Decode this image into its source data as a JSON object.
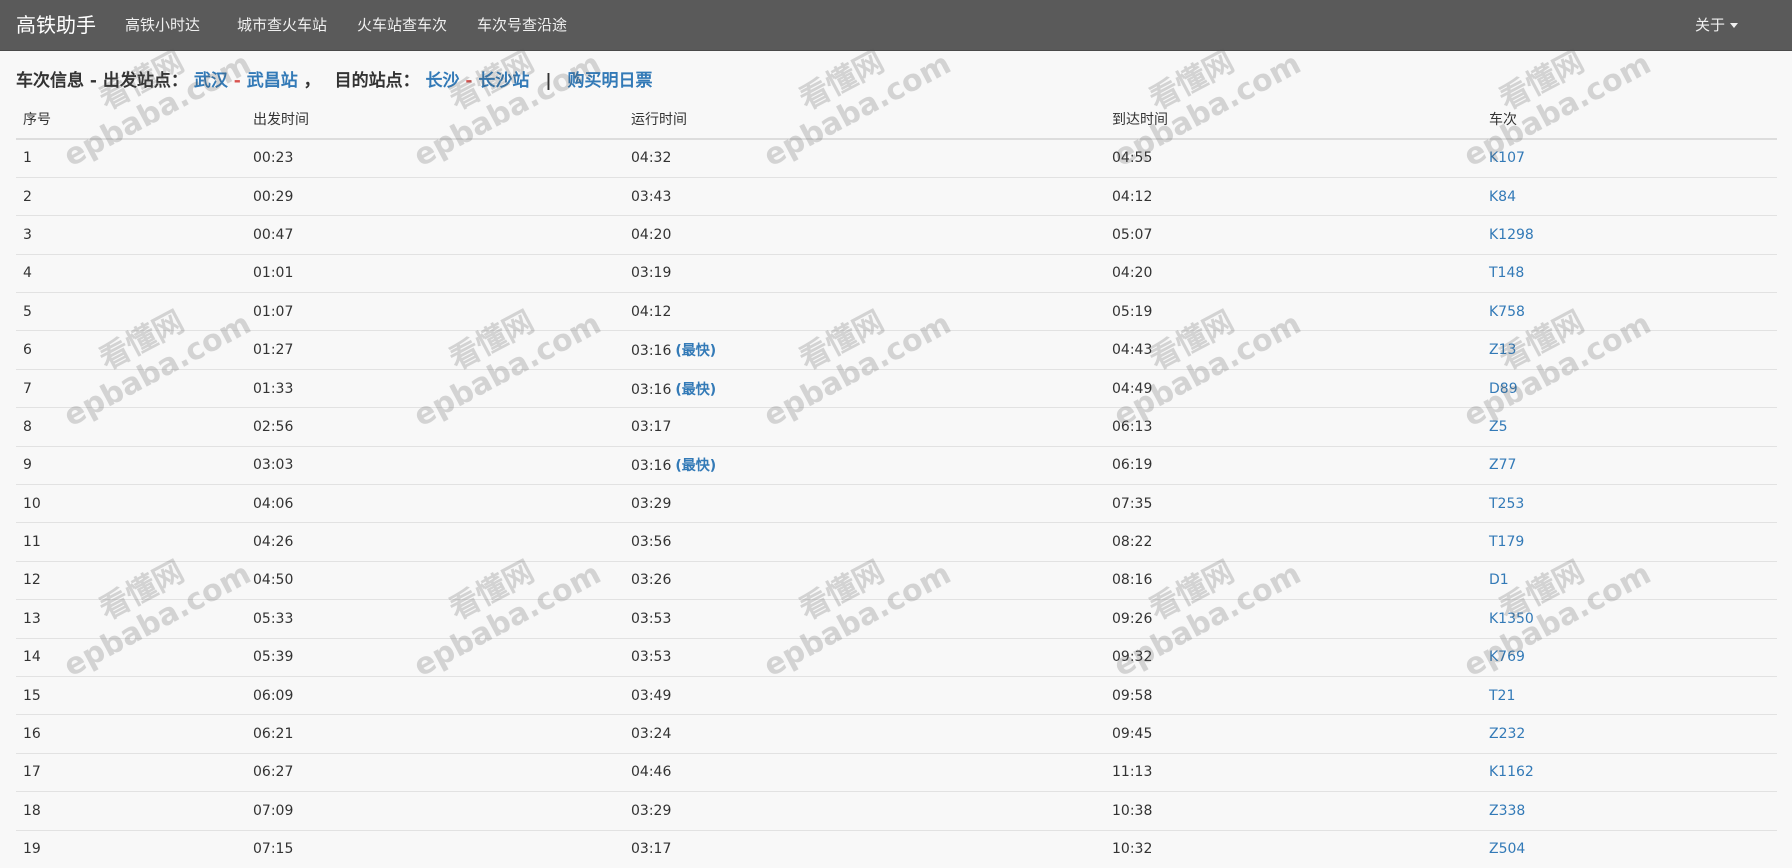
{
  "navbar": {
    "brand": "高铁助手",
    "items": [
      "高铁小时达",
      "城市查火车站",
      "火车站查车次",
      "车次号查沿途"
    ],
    "about": "关于"
  },
  "info": {
    "prefix": "车次信息 - 出发站点：",
    "from_city": "武汉",
    "dash": "-",
    "from_station": "武昌站",
    "separator": "，",
    "dest_label": "目的站点：",
    "to_city": "长沙",
    "to_station": "长沙站",
    "bar": "|",
    "buy": "购买明日票"
  },
  "table": {
    "headers": [
      "序号",
      "出发时间",
      "运行时间",
      "到达时间",
      "车次"
    ],
    "fast_label": "(最快)",
    "rows": [
      {
        "no": "1",
        "dep": "00:23",
        "dur": "04:32",
        "arr": "04:55",
        "train": "K107",
        "fast": false
      },
      {
        "no": "2",
        "dep": "00:29",
        "dur": "03:43",
        "arr": "04:12",
        "train": "K84",
        "fast": false
      },
      {
        "no": "3",
        "dep": "00:47",
        "dur": "04:20",
        "arr": "05:07",
        "train": "K1298",
        "fast": false
      },
      {
        "no": "4",
        "dep": "01:01",
        "dur": "03:19",
        "arr": "04:20",
        "train": "T148",
        "fast": false
      },
      {
        "no": "5",
        "dep": "01:07",
        "dur": "04:12",
        "arr": "05:19",
        "train": "K758",
        "fast": false
      },
      {
        "no": "6",
        "dep": "01:27",
        "dur": "03:16",
        "arr": "04:43",
        "train": "Z13",
        "fast": true
      },
      {
        "no": "7",
        "dep": "01:33",
        "dur": "03:16",
        "arr": "04:49",
        "train": "D89",
        "fast": true
      },
      {
        "no": "8",
        "dep": "02:56",
        "dur": "03:17",
        "arr": "06:13",
        "train": "Z5",
        "fast": false
      },
      {
        "no": "9",
        "dep": "03:03",
        "dur": "03:16",
        "arr": "06:19",
        "train": "Z77",
        "fast": true
      },
      {
        "no": "10",
        "dep": "04:06",
        "dur": "03:29",
        "arr": "07:35",
        "train": "T253",
        "fast": false
      },
      {
        "no": "11",
        "dep": "04:26",
        "dur": "03:56",
        "arr": "08:22",
        "train": "T179",
        "fast": false
      },
      {
        "no": "12",
        "dep": "04:50",
        "dur": "03:26",
        "arr": "08:16",
        "train": "D1",
        "fast": false
      },
      {
        "no": "13",
        "dep": "05:33",
        "dur": "03:53",
        "arr": "09:26",
        "train": "K1350",
        "fast": false
      },
      {
        "no": "14",
        "dep": "05:39",
        "dur": "03:53",
        "arr": "09:32",
        "train": "K769",
        "fast": false
      },
      {
        "no": "15",
        "dep": "06:09",
        "dur": "03:49",
        "arr": "09:58",
        "train": "T21",
        "fast": false
      },
      {
        "no": "16",
        "dep": "06:21",
        "dur": "03:24",
        "arr": "09:45",
        "train": "Z232",
        "fast": false
      },
      {
        "no": "17",
        "dep": "06:27",
        "dur": "04:46",
        "arr": "11:13",
        "train": "K1162",
        "fast": false
      },
      {
        "no": "18",
        "dep": "07:09",
        "dur": "03:29",
        "arr": "10:38",
        "train": "Z338",
        "fast": false
      },
      {
        "no": "19",
        "dep": "07:15",
        "dur": "03:17",
        "arr": "10:32",
        "train": "Z504",
        "fast": false
      }
    ]
  },
  "watermark": {
    "cn": "看懂网",
    "en": "epbaba.com"
  }
}
